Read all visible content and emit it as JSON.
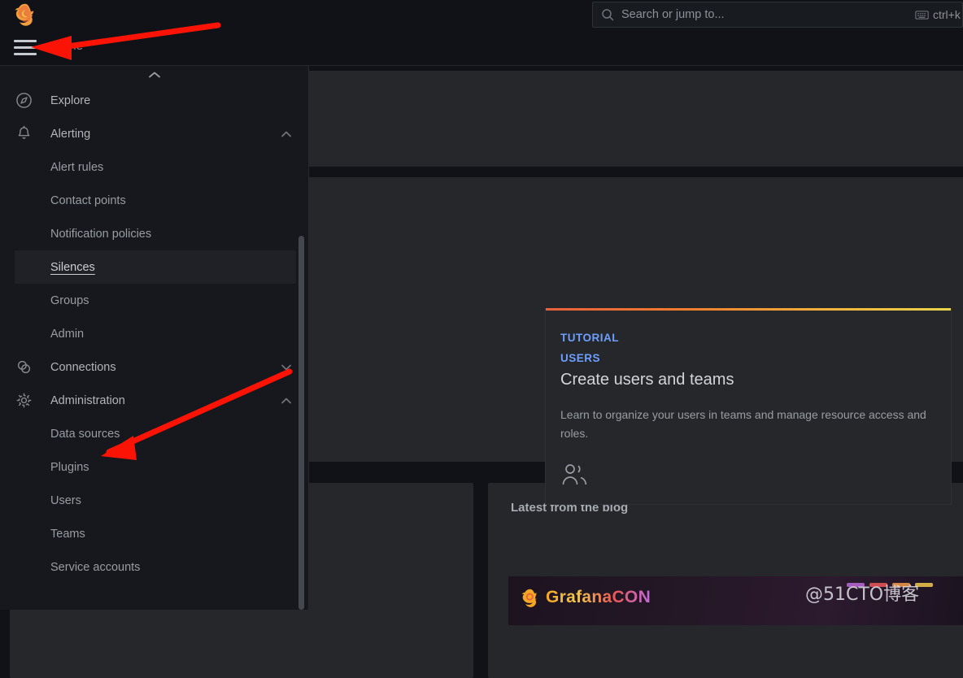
{
  "app": {
    "logo_icon": "grafana-logo-icon",
    "watermark": "@51CTO博客"
  },
  "header": {
    "menu_icon": "hamburger-menu-icon",
    "breadcrumb": "Home",
    "search": {
      "icon": "search-icon",
      "placeholder": "Search or jump to...",
      "value": "",
      "shortcut_icon": "keyboard-icon",
      "shortcut_label": "ctrl+k"
    }
  },
  "nav": {
    "scroll_up_icon": "chevron-up-icon",
    "items": [
      {
        "label": "Explore",
        "icon": "compass-icon",
        "level": "top",
        "chevron": "",
        "active": false
      },
      {
        "label": "Alerting",
        "icon": "bell-icon",
        "level": "top",
        "chevron": "chevron-up-icon",
        "active": false
      },
      {
        "label": "Alert rules",
        "icon": "",
        "level": "sub",
        "chevron": "",
        "active": false
      },
      {
        "label": "Contact points",
        "icon": "",
        "level": "sub",
        "chevron": "",
        "active": false
      },
      {
        "label": "Notification policies",
        "icon": "",
        "level": "sub",
        "chevron": "",
        "active": false
      },
      {
        "label": "Silences",
        "icon": "",
        "level": "sub",
        "chevron": "",
        "active": true
      },
      {
        "label": "Groups",
        "icon": "",
        "level": "sub",
        "chevron": "",
        "active": false
      },
      {
        "label": "Admin",
        "icon": "",
        "level": "sub",
        "chevron": "",
        "active": false
      },
      {
        "label": "Connections",
        "icon": "connections-icon",
        "level": "top",
        "chevron": "chevron-down-icon",
        "active": false
      },
      {
        "label": "Administration",
        "icon": "gear-icon",
        "level": "top",
        "chevron": "chevron-up-icon",
        "active": false
      },
      {
        "label": "Data sources",
        "icon": "",
        "level": "sub",
        "chevron": "",
        "active": false
      },
      {
        "label": "Plugins",
        "icon": "",
        "level": "sub",
        "chevron": "",
        "active": false
      },
      {
        "label": "Users",
        "icon": "",
        "level": "sub",
        "chevron": "",
        "active": false
      },
      {
        "label": "Teams",
        "icon": "",
        "level": "sub",
        "chevron": "",
        "active": false
      },
      {
        "label": "Service accounts",
        "icon": "",
        "level": "sub",
        "chevron": "",
        "active": false
      }
    ]
  },
  "main": {
    "tutorial_card": {
      "eyebrow_line1": "TUTORIAL",
      "eyebrow_line2": "USERS",
      "title": "Create users and teams",
      "description": "Learn to organize your users in teams and manage resource access and roles.",
      "icon": "users-group-icon",
      "accent_from": "#e8603c",
      "accent_to": "#e8d44d"
    },
    "blog_panel": {
      "title": "Latest from the blog",
      "banner_text": "GrafanaCON",
      "banner_logo_icon": "grafana-logo-icon"
    }
  },
  "annotations": {
    "arrow_color": "#fb1405",
    "arrows": [
      {
        "name": "arrow-to-hamburger-menu",
        "target": "hamburger-menu-icon"
      },
      {
        "name": "arrow-to-data-sources",
        "target": "nav-item-data-sources"
      }
    ]
  }
}
